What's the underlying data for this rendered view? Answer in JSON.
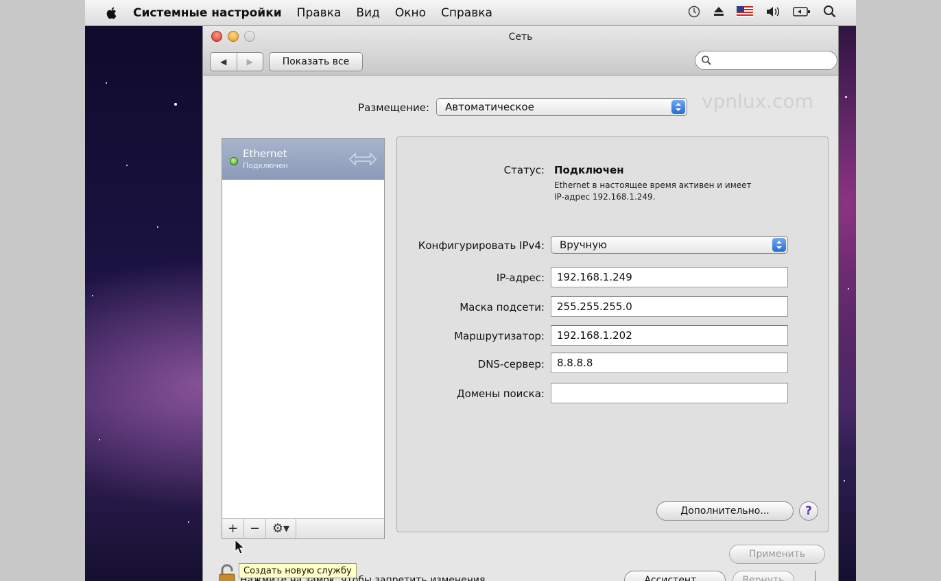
{
  "menubar": {
    "app": "Системные настройки",
    "items": [
      "Правка",
      "Вид",
      "Окно",
      "Справка"
    ],
    "status_icons": [
      "time-machine-icon",
      "eject-icon",
      "flag-us-icon",
      "volume-icon",
      "battery-icon",
      "spotlight-icon"
    ]
  },
  "window": {
    "title": "Сеть",
    "show_all": "Показать все",
    "search_placeholder": ""
  },
  "watermark": "vpnlux.com",
  "location": {
    "label": "Размещение:",
    "value": "Автоматическое"
  },
  "services": [
    {
      "name": "Ethernet",
      "status": "Подключен"
    }
  ],
  "status": {
    "label": "Статус:",
    "value": "Подключен",
    "description": "Ethernet в настоящее время активен и имеет IP-адрес 192.168.1.249."
  },
  "ipv4": {
    "label": "Конфигурировать IPv4:",
    "value": "Вручную"
  },
  "fields": [
    {
      "label": "IP-адрес:",
      "value": "192.168.1.249"
    },
    {
      "label": "Маска подсети:",
      "value": "255.255.255.0"
    },
    {
      "label": "Маршрутизатор:",
      "value": "192.168.1.202"
    },
    {
      "label": "DNS-сервер:",
      "value": "8.8.8.8"
    },
    {
      "label": "Домены поиска:",
      "value": ""
    }
  ],
  "buttons": {
    "advanced": "Дополнительно...",
    "help": "?",
    "assistant": "Ассистент...",
    "revert": "Вернуть",
    "apply": "Применить"
  },
  "toolbar": {
    "add": "+",
    "remove": "−",
    "gear": "⚙▾"
  },
  "tooltip": "Создать новую службу",
  "lock_text": "Нажмите на замок, чтобы запретить изменения."
}
